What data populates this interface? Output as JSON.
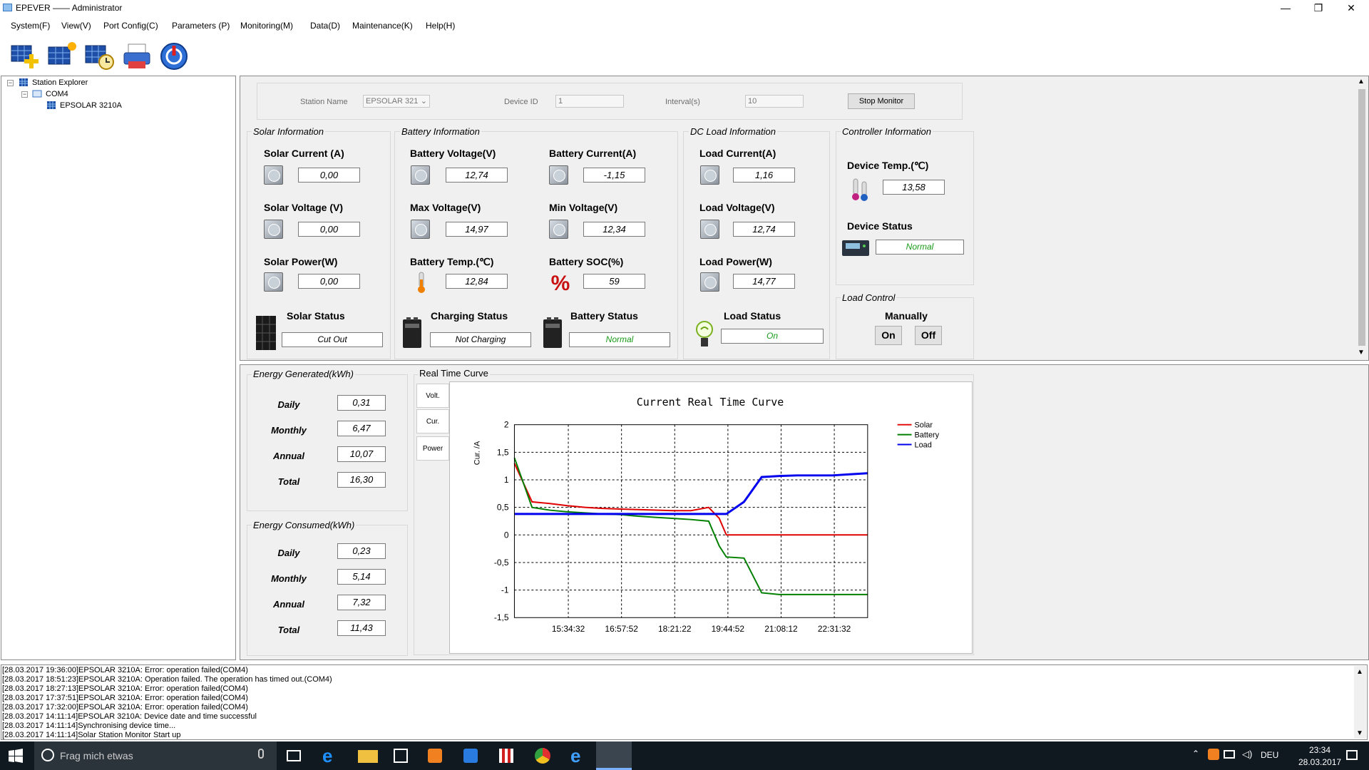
{
  "window": {
    "title": "EPEVER —— Administrator",
    "minimize": "—",
    "restore": "❐",
    "close": "✕"
  },
  "menu": [
    "System(F)",
    "View(V)",
    "Port Config(C)",
    "Parameters (P)",
    "Monitoring(M)",
    "Data(D)",
    "Maintenance(K)",
    "Help(H)"
  ],
  "tree": {
    "root": "Station Explorer",
    "port": "COM4",
    "device": "EPSOLAR 3210A"
  },
  "monitor": {
    "station_label": "Station Name",
    "station_value": "EPSOLAR 321",
    "device_id_label": "Device ID",
    "device_id_value": "1",
    "interval_label": "Interval(s)",
    "interval_value": "10",
    "stop_button": "Stop Monitor"
  },
  "solar": {
    "title": "Solar Information",
    "current_label": "Solar Current (A)",
    "current": "0,00",
    "voltage_label": "Solar Voltage (V)",
    "voltage": "0,00",
    "power_label": "Solar Power(W)",
    "power": "0,00",
    "status_label": "Solar Status",
    "status": "Cut Out"
  },
  "battery": {
    "title": "Battery Information",
    "voltage_label": "Battery Voltage(V)",
    "voltage": "12,74",
    "current_label": "Battery Current(A)",
    "current": "-1,15",
    "max_label": "Max Voltage(V)",
    "max": "14,97",
    "min_label": "Min Voltage(V)",
    "min": "12,34",
    "temp_label": "Battery Temp.(℃)",
    "temp": "12,84",
    "soc_label": "Battery SOC(%)",
    "soc": "59",
    "charging_label": "Charging Status",
    "charging": "Not Charging",
    "status_label": "Battery Status",
    "status": "Normal"
  },
  "load": {
    "title": "DC Load Information",
    "current_label": "Load Current(A)",
    "current": "1,16",
    "voltage_label": "Load Voltage(V)",
    "voltage": "12,74",
    "power_label": "Load Power(W)",
    "power": "14,77",
    "status_label": "Load Status",
    "status": "On"
  },
  "controller": {
    "title": "Controller Information",
    "temp_label": "Device Temp.(℃)",
    "temp": "13,58",
    "status_label": "Device Status",
    "status": "Normal"
  },
  "load_control": {
    "title": "Load Control",
    "mode": "Manually",
    "on": "On",
    "off": "Off"
  },
  "energy_generated": {
    "title": "Energy Generated(kWh)",
    "daily_label": "Daily",
    "daily": "0,31",
    "monthly_label": "Monthly",
    "monthly": "6,47",
    "annual_label": "Annual",
    "annual": "10,07",
    "total_label": "Total",
    "total": "16,30"
  },
  "energy_consumed": {
    "title": "Energy Consumed(kWh)",
    "daily_label": "Daily",
    "daily": "0,23",
    "monthly_label": "Monthly",
    "monthly": "5,14",
    "annual_label": "Annual",
    "annual": "7,32",
    "total_label": "Total",
    "total": "11,43"
  },
  "curve": {
    "group_title": "Real Time Curve",
    "tabs": [
      "Volt.",
      "Cur.",
      "Power"
    ]
  },
  "chart_data": {
    "type": "line",
    "title": "Current Real Time Curve",
    "ylabel": "Cur. /A",
    "ylim": [
      -1.5,
      2
    ],
    "yticks": [
      "2",
      "1,5",
      "1",
      "0,5",
      "0",
      "-0,5",
      "-1",
      "-1,5"
    ],
    "xticks": [
      "15:34:32",
      "16:57:52",
      "18:21:22",
      "19:44:52",
      "21:08:12",
      "22:31:32"
    ],
    "x": [
      0,
      5,
      10,
      15,
      20,
      25,
      30,
      35,
      40,
      45,
      50,
      55,
      58,
      60,
      65,
      70,
      75,
      80,
      85,
      90,
      95,
      100
    ],
    "series": [
      {
        "name": "Solar",
        "color": "#e00000",
        "values": [
          1.3,
          0.6,
          0.57,
          0.53,
          0.5,
          0.48,
          0.47,
          0.46,
          0.45,
          0.44,
          0.44,
          0.5,
          0.3,
          0.0,
          0.0,
          0.0,
          0.0,
          0.0,
          0.0,
          0.0,
          0.0,
          0.0
        ]
      },
      {
        "name": "Battery",
        "color": "#008000",
        "values": [
          1.4,
          0.5,
          0.45,
          0.42,
          0.4,
          0.38,
          0.37,
          0.34,
          0.32,
          0.3,
          0.28,
          0.25,
          -0.2,
          -0.4,
          -0.42,
          -1.05,
          -1.08,
          -1.08,
          -1.08,
          -1.08,
          -1.08,
          -1.08
        ]
      },
      {
        "name": "Load",
        "color": "#0000ee",
        "values": [
          0.38,
          0.38,
          0.38,
          0.38,
          0.38,
          0.38,
          0.38,
          0.38,
          0.38,
          0.38,
          0.38,
          0.38,
          0.38,
          0.38,
          0.6,
          1.05,
          1.07,
          1.08,
          1.08,
          1.08,
          1.1,
          1.12
        ]
      }
    ],
    "legend": "top-right",
    "grid": true
  },
  "log": [
    "[28.03.2017 19:36:00]EPSOLAR 3210A: Error: operation failed(COM4)",
    "[28.03.2017 18:51:23]EPSOLAR 3210A: Operation failed. The operation has timed out.(COM4)",
    "[28.03.2017 18:27:13]EPSOLAR 3210A: Error: operation failed(COM4)",
    "[28.03.2017 17:37:51]EPSOLAR 3210A: Error: operation failed(COM4)",
    "[28.03.2017 17:32:00]EPSOLAR 3210A: Error: operation failed(COM4)",
    "[28.03.2017 14:11:14]EPSOLAR 3210A: Device date and time successful",
    "[28.03.2017 14:11:14]Synchronising device time...",
    "[28.03.2017 14:11:14]Solar Station Monitor Start up"
  ],
  "taskbar": {
    "search": "Frag mich etwas",
    "lang": "DEU",
    "time": "23:34",
    "date": "28.03.2017"
  }
}
